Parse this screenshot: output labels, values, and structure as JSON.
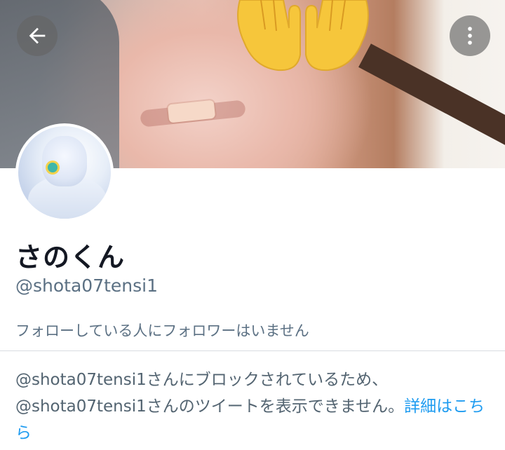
{
  "header": {
    "back_icon": "arrow-left-icon",
    "more_icon": "more-vertical-icon",
    "emoji": "raising-hands-emoji",
    "colors": {
      "button_bg": "#646464",
      "emoji_yellow": "#f6c63b"
    }
  },
  "profile": {
    "display_name": "さのくん",
    "handle": "@shota07tensi1",
    "follow_note": "フォローしている人にフォロワーはいません"
  },
  "blocked": {
    "message": "@shota07tensi1さんにブロックされているため、@shota07tensi1さんのツイートを表示できません。",
    "link_label": "詳細はこちら"
  },
  "theme": {
    "text_primary": "#141823",
    "text_secondary": "#5b7083",
    "link": "#1d9bf0",
    "divider": "#d9dde1"
  }
}
